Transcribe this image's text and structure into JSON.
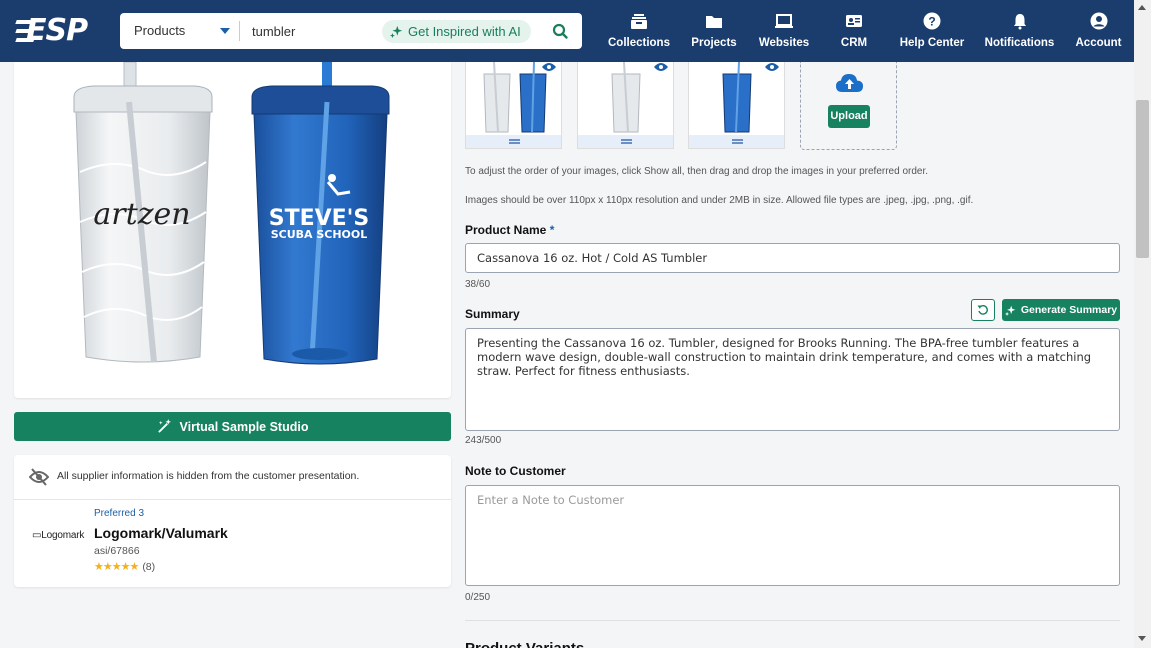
{
  "header": {
    "logo": "ESP",
    "search": {
      "category": "Products",
      "query": "tumbler",
      "ai_label": "Get Inspired with AI"
    },
    "nav": [
      {
        "label": "Collections",
        "icon": "collections-icon"
      },
      {
        "label": "Projects",
        "icon": "folder-icon"
      },
      {
        "label": "Websites",
        "icon": "monitor-icon"
      },
      {
        "label": "CRM",
        "icon": "contact-card-icon"
      },
      {
        "label": "Help Center",
        "icon": "help-icon"
      },
      {
        "label": "Notifications",
        "icon": "bell-icon"
      },
      {
        "label": "Account",
        "icon": "account-icon"
      }
    ]
  },
  "left": {
    "virtual_sample_label": "Virtual Sample Studio",
    "hidden_note": "All supplier information is hidden from the customer presentation.",
    "supplier": {
      "logo_text": "Logomark",
      "preferred": "Preferred 3",
      "name": "Logomark/Valumark",
      "asi": "asi/67866",
      "rating": 5,
      "review_count": "(8)"
    }
  },
  "images": {
    "upload_label": "Upload",
    "order_help": "To adjust the order of your images, click Show all, then drag and drop the images in your preferred order.",
    "size_help": "Images should be over 110px x 110px resolution and under 2MB in size. Allowed file types are .jpeg, .jpg, .png, .gif."
  },
  "product_name": {
    "label": "Product Name",
    "required_mark": "*",
    "value": "Cassanova 16 oz. Hot / Cold AS Tumbler",
    "counter": "38/60"
  },
  "summary": {
    "label": "Summary",
    "generate_label": "Generate Summary",
    "value": "Presenting the Cassanova 16 oz. Tumbler, designed for Brooks Running. The BPA-free tumbler features a modern wave design, double-wall construction to maintain drink temperature, and comes with a matching straw. Perfect for fitness enthusiasts.",
    "counter": "243/500"
  },
  "note": {
    "label": "Note to Customer",
    "placeholder": "Enter a Note to Customer",
    "counter": "0/250"
  },
  "next_section": "Product Variants",
  "product_imprint": {
    "clear_cup": "artzen",
    "blue_cup_line1": "STEVE'S",
    "blue_cup_line2": "SCUBA SCHOOL"
  },
  "colors": {
    "header": "#1b3d6e",
    "accent_green": "#17825f",
    "link_blue": "#1b5fa8",
    "cup_blue": "#1f5fb4"
  }
}
